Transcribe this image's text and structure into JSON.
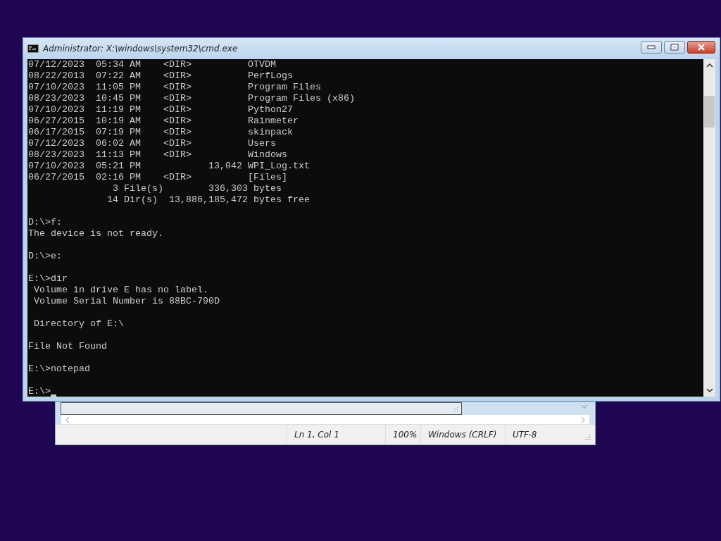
{
  "console_window": {
    "title": "Administrator: X:\\windows\\system32\\cmd.exe",
    "blocks": [
      [
        "07/12/2023  05:34 AM    <DIR>          OTVDM",
        "08/22/2013  07:22 AM    <DIR>          PerfLogs",
        "07/10/2023  11:05 PM    <DIR>          Program Files",
        "08/23/2023  10:45 PM    <DIR>          Program Files (x86)",
        "07/10/2023  11:19 PM    <DIR>          Python27",
        "06/27/2015  10:19 AM    <DIR>          Rainmeter",
        "06/17/2015  07:19 PM    <DIR>          skinpack",
        "07/12/2023  06:02 AM    <DIR>          Users",
        "08/23/2023  11:13 PM    <DIR>          Windows",
        "07/10/2023  05:21 PM            13,042 WPI_Log.txt",
        "06/27/2015  02:16 PM    <DIR>          [Files]",
        "               3 File(s)        336,303 bytes",
        "              14 Dir(s)  13,886,185,472 bytes free"
      ],
      [
        "D:\\>f:",
        "The device is not ready."
      ],
      [
        "D:\\>e:"
      ],
      [
        "E:\\>dir",
        " Volume in drive E has no label.",
        " Volume Serial Number is 88BC-790D"
      ],
      [
        " Directory of E:\\"
      ],
      [
        "File Not Found"
      ],
      [
        "E:\\>notepad"
      ],
      [
        "E:\\>"
      ]
    ]
  },
  "notepad_window": {
    "status_bar": [
      "Ln 1, Col 1",
      "100%",
      "Windows (CRLF)",
      "UTF-8"
    ]
  }
}
